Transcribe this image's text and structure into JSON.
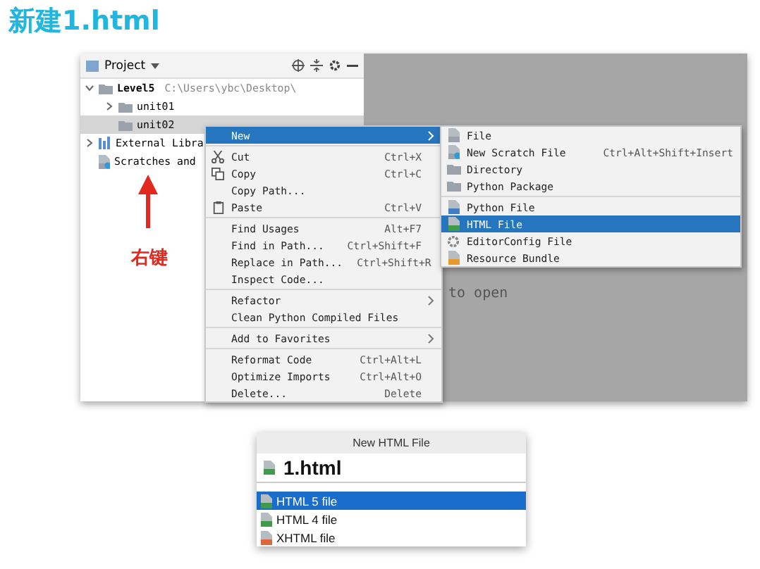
{
  "title": "新建1.html",
  "ide": {
    "panel_title": "Project",
    "tree": [
      {
        "label": "Level5",
        "path": "C:\\Users\\ybc\\Desktop\\",
        "expanded": true,
        "selected": false,
        "kind": "folder",
        "children": [
          {
            "label": "unit01",
            "expanded": false,
            "selected": false,
            "kind": "folder"
          },
          {
            "label": "unit02",
            "selected": true,
            "kind": "folder"
          }
        ]
      },
      {
        "label": "External Libra",
        "expanded": false,
        "selected": false,
        "kind": "library"
      },
      {
        "label": "Scratches and",
        "selected": false,
        "kind": "scratch"
      }
    ],
    "editor_hint": "to open",
    "annotation": "右键",
    "context_menu": [
      [
        {
          "label": "New",
          "submenu": true,
          "selected": true
        }
      ],
      [
        {
          "label": "Cut",
          "shortcut": "Ctrl+X",
          "submenu": false,
          "selected": false
        },
        {
          "label": "Copy",
          "shortcut": "Ctrl+C",
          "submenu": false,
          "selected": false
        },
        {
          "label": "Copy Path...",
          "submenu": false,
          "selected": false
        },
        {
          "label": "Paste",
          "shortcut": "Ctrl+V",
          "submenu": false,
          "selected": false
        }
      ],
      [
        {
          "label": "Find Usages",
          "shortcut": "Alt+F7",
          "submenu": false,
          "selected": false
        },
        {
          "label": "Find in Path...",
          "shortcut": "Ctrl+Shift+F",
          "submenu": false,
          "selected": false
        },
        {
          "label": "Replace in Path...",
          "shortcut": "Ctrl+Shift+R",
          "submenu": false,
          "selected": false
        },
        {
          "label": "Inspect Code...",
          "submenu": false,
          "selected": false
        }
      ],
      [
        {
          "label": "Refactor",
          "submenu": true,
          "selected": false
        },
        {
          "label": "Clean Python Compiled Files",
          "submenu": false,
          "selected": false
        }
      ],
      [
        {
          "label": "Add to Favorites",
          "submenu": true,
          "selected": false
        }
      ],
      [
        {
          "label": "Reformat Code",
          "shortcut": "Ctrl+Alt+L",
          "submenu": false,
          "selected": false
        },
        {
          "label": "Optimize Imports",
          "shortcut": "Ctrl+Alt+O",
          "submenu": false,
          "selected": false
        },
        {
          "label": "Delete...",
          "shortcut": "Delete",
          "submenu": false,
          "selected": false
        }
      ]
    ],
    "new_submenu": [
      [
        {
          "label": "File",
          "selected": false
        },
        {
          "label": "New Scratch File",
          "shortcut": "Ctrl+Alt+Shift+Insert",
          "selected": false
        },
        {
          "label": "Directory",
          "selected": false
        },
        {
          "label": "Python Package",
          "selected": false
        }
      ],
      [
        {
          "label": "Python File",
          "selected": false
        },
        {
          "label": "HTML File",
          "selected": true
        },
        {
          "label": "EditorConfig File",
          "selected": false
        },
        {
          "label": "Resource Bundle",
          "selected": false
        }
      ]
    ]
  },
  "dialog": {
    "title": "New HTML File",
    "value": "1.html",
    "options": [
      {
        "label": "HTML 5 file",
        "selected": true,
        "kind": "html"
      },
      {
        "label": "HTML 4 file",
        "selected": false,
        "kind": "html"
      },
      {
        "label": "XHTML file",
        "selected": false,
        "kind": "xhtml"
      }
    ]
  }
}
